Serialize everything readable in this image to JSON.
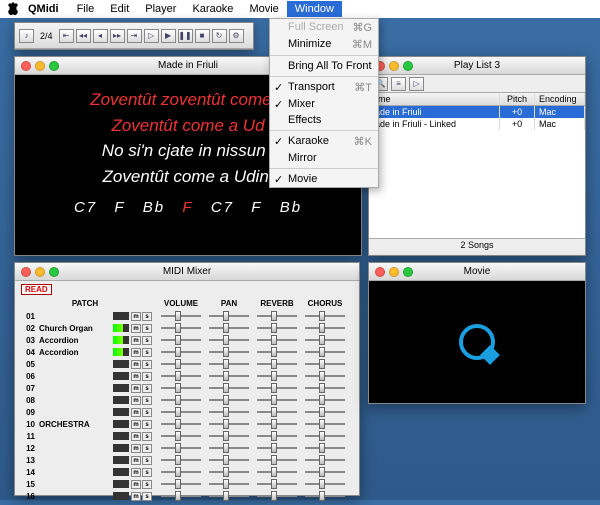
{
  "menubar": {
    "app": "QMidi",
    "items": [
      "File",
      "Edit",
      "Player",
      "Karaoke",
      "Movie",
      "Window"
    ]
  },
  "dropdown": {
    "full_screen": "Full Screen",
    "sc_fs": "⌘G",
    "minimize": "Minimize",
    "sc_min": "⌘M",
    "bring_front": "Bring All To Front",
    "transport": "Transport",
    "sc_tr": "⌘T",
    "mixer": "Mixer",
    "effects": "Effects",
    "karaoke": "Karaoke",
    "sc_kar": "⌘K",
    "mirror": "Mirror",
    "movie": "Movie"
  },
  "karaoke_win": {
    "title": "Made in Friuli",
    "l1a": "Zoventût zoventût come a ",
    "l2": "Zoventût come a Ud",
    "l3": "No si'n cjate in nissun l",
    "l4": "Zoventût come a Udin,",
    "chords": [
      "C7",
      "F",
      "Bb",
      "F",
      "C7",
      "F",
      "Bb"
    ]
  },
  "playlist": {
    "title": "Play List 3",
    "head_name": "ame",
    "head_pitch": "Pitch",
    "head_enc": "Encoding",
    "rows": [
      {
        "name": "lade in Friuli",
        "pitch": "+0",
        "enc": "Mac"
      },
      {
        "name": "lade in Friuli - Linked",
        "pitch": "+0",
        "enc": "Mac"
      }
    ],
    "status": "2 Songs"
  },
  "mixer_win": {
    "title": "MIDI Mixer",
    "read": "READ",
    "head": {
      "patch": "PATCH",
      "vol": "VOLUME",
      "pan": "PAN",
      "rev": "REVERB",
      "cho": "CHORUS"
    },
    "rows": [
      {
        "ch": "01",
        "patch": "",
        "meter": false
      },
      {
        "ch": "02",
        "patch": "Church Organ",
        "meter": true
      },
      {
        "ch": "03",
        "patch": "Accordion",
        "meter": true
      },
      {
        "ch": "04",
        "patch": "Accordion",
        "meter": true
      },
      {
        "ch": "05",
        "patch": "",
        "meter": false
      },
      {
        "ch": "06",
        "patch": "",
        "meter": false
      },
      {
        "ch": "07",
        "patch": "",
        "meter": false
      },
      {
        "ch": "08",
        "patch": "",
        "meter": false
      },
      {
        "ch": "09",
        "patch": "",
        "meter": false
      },
      {
        "ch": "10",
        "patch": "ORCHESTRA",
        "meter": false
      },
      {
        "ch": "11",
        "patch": "",
        "meter": false
      },
      {
        "ch": "12",
        "patch": "",
        "meter": false
      },
      {
        "ch": "13",
        "patch": "",
        "meter": false
      },
      {
        "ch": "14",
        "patch": "",
        "meter": false
      },
      {
        "ch": "15",
        "patch": "",
        "meter": false
      },
      {
        "ch": "16",
        "patch": "",
        "meter": false
      }
    ]
  },
  "movie_win": {
    "title": "Movie"
  },
  "toolbar_info": {
    "tempo": "2/4"
  }
}
